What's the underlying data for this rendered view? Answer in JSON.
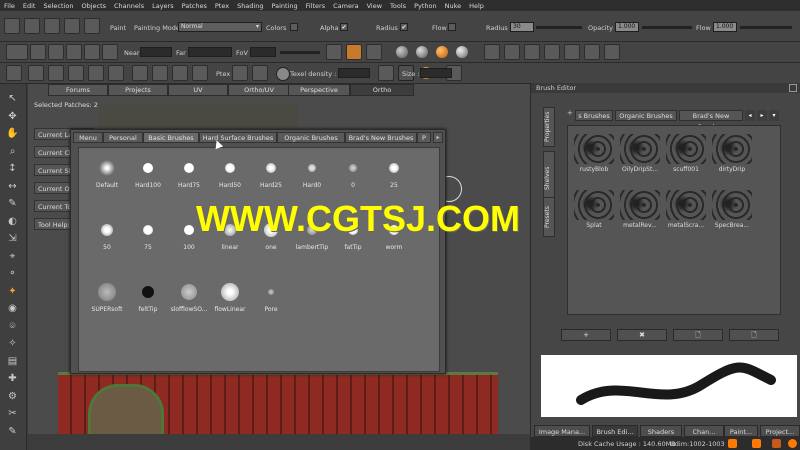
{
  "menubar": [
    "File",
    "Edit",
    "Selection",
    "Objects",
    "Channels",
    "Layers",
    "Patches",
    "Ptex",
    "Shading",
    "Painting",
    "Filters",
    "Camera",
    "View",
    "Tools",
    "Python",
    "Nuke",
    "Help"
  ],
  "toolbar1": {
    "paint_label": "Paint",
    "painting_mode_label": "Painting Mode",
    "painting_mode_value": "Normal",
    "colors_label": "Colors",
    "alpha_label": "Alpha",
    "radius_chk_label": "Radius",
    "flow_chk_label": "Flow",
    "radius_label": "Radius",
    "radius_value": "30",
    "opacity_label": "Opacity",
    "opacity_value": "1.000",
    "flow_label": "Flow",
    "flow_value": "1.000",
    "check_mark": "✔"
  },
  "toolbar2": {
    "near_label": "Near",
    "far_label": "Far",
    "fov_label": "FoV"
  },
  "toolbar3": {
    "ptex_label": "Ptex",
    "texel_label": "Texel density :",
    "size_label": "Size :"
  },
  "viewport": {
    "tabs": [
      "Forums",
      "Projects",
      "UV",
      "Ortho/UV",
      "Perspective",
      "Ortho"
    ],
    "active_tab": "Ortho",
    "selected_patches": "Selected Patches: 2",
    "side_labels": [
      "Current La",
      "Current Ch",
      "Current Sh",
      "Current Ob",
      "Current To",
      "Tool Help:"
    ]
  },
  "popup": {
    "tabs": [
      "Menu",
      "Personal",
      "Basic Brushes",
      "Hard Surface Brushes",
      "Organic Brushes",
      "Brad's New Brushes",
      "P"
    ],
    "active_tab": "Basic Brushes",
    "brushes": [
      "Default",
      "Hard100",
      "Hard75",
      "Hard50",
      "Hard25",
      "Hard0",
      "0",
      "25",
      "50",
      "75",
      "100",
      "linear",
      "one",
      "lambertTip",
      "fatTip",
      "worm",
      "SUPERsoft",
      "feltTip",
      "slofflowSO...",
      "flowLinear",
      "Pore"
    ]
  },
  "brush_editor": {
    "title": "Brush Editor",
    "side_tabs": [
      "Properties",
      "Shelves",
      "Presets"
    ],
    "tabs": [
      "s Brushes",
      "Organic Brushes",
      "Brad's New Brushes"
    ],
    "thumbs": [
      "rustyBlob",
      "OilyDripSt...",
      "scuff001",
      "dirtyDrip",
      "Splat",
      "metalRev...",
      "metalScra...",
      "SpecBrea..."
    ],
    "buttons": [
      "+",
      "✖",
      "🗋",
      "🗋"
    ],
    "bottom_tabs": [
      "Image Mana...",
      "Brush Edi...",
      "Shaders",
      "Chan...",
      "Paint...",
      "Project..."
    ],
    "status": "Disk Cache Usage : 140.60MB",
    "udim": "Udim:1002-1003"
  },
  "watermark": "WWW.CGTSJ.COM",
  "colors": {
    "accent": "#ff8a00",
    "watermark": "#ffff00"
  }
}
